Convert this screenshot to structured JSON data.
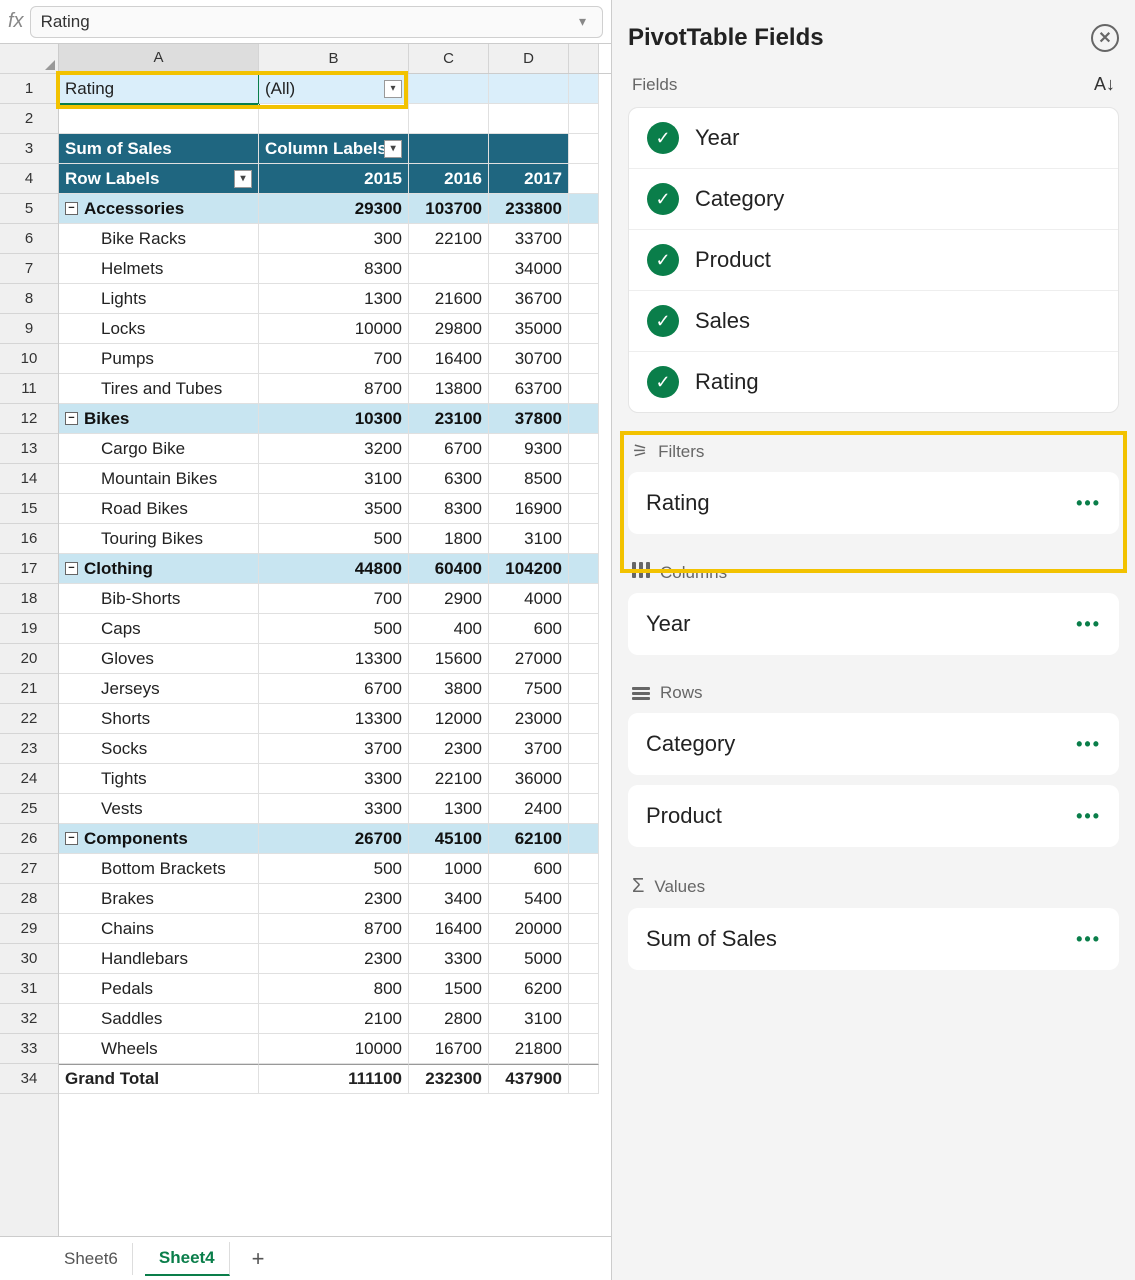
{
  "formula_bar": {
    "fx": "fx",
    "value": "Rating"
  },
  "columns": [
    "A",
    "B",
    "C",
    "D"
  ],
  "row_numbers": [
    1,
    2,
    3,
    4,
    5,
    6,
    7,
    8,
    9,
    10,
    11,
    12,
    13,
    14,
    15,
    16,
    17,
    18,
    19,
    20,
    21,
    22,
    23,
    24,
    25,
    26,
    27,
    28,
    29,
    30,
    31,
    32,
    33,
    34
  ],
  "pivot": {
    "filter_label": "Rating",
    "filter_value": "(All)",
    "sum_label": "Sum of Sales",
    "col_label": "Column Labels",
    "row_label": "Row Labels",
    "years": [
      "2015",
      "2016",
      "2017"
    ],
    "groups": [
      {
        "name": "Accessories",
        "totals": [
          "29300",
          "103700",
          "233800"
        ],
        "rows": [
          {
            "name": "Bike Racks",
            "v": [
              "300",
              "22100",
              "33700"
            ]
          },
          {
            "name": "Helmets",
            "v": [
              "8300",
              "",
              "34000"
            ]
          },
          {
            "name": "Lights",
            "v": [
              "1300",
              "21600",
              "36700"
            ]
          },
          {
            "name": "Locks",
            "v": [
              "10000",
              "29800",
              "35000"
            ]
          },
          {
            "name": "Pumps",
            "v": [
              "700",
              "16400",
              "30700"
            ]
          },
          {
            "name": "Tires and Tubes",
            "v": [
              "8700",
              "13800",
              "63700"
            ]
          }
        ]
      },
      {
        "name": "Bikes",
        "totals": [
          "10300",
          "23100",
          "37800"
        ],
        "rows": [
          {
            "name": "Cargo Bike",
            "v": [
              "3200",
              "6700",
              "9300"
            ]
          },
          {
            "name": "Mountain Bikes",
            "v": [
              "3100",
              "6300",
              "8500"
            ]
          },
          {
            "name": "Road Bikes",
            "v": [
              "3500",
              "8300",
              "16900"
            ]
          },
          {
            "name": "Touring Bikes",
            "v": [
              "500",
              "1800",
              "3100"
            ]
          }
        ]
      },
      {
        "name": "Clothing",
        "totals": [
          "44800",
          "60400",
          "104200"
        ],
        "rows": [
          {
            "name": "Bib-Shorts",
            "v": [
              "700",
              "2900",
              "4000"
            ]
          },
          {
            "name": "Caps",
            "v": [
              "500",
              "400",
              "600"
            ]
          },
          {
            "name": "Gloves",
            "v": [
              "13300",
              "15600",
              "27000"
            ]
          },
          {
            "name": "Jerseys",
            "v": [
              "6700",
              "3800",
              "7500"
            ]
          },
          {
            "name": "Shorts",
            "v": [
              "13300",
              "12000",
              "23000"
            ]
          },
          {
            "name": "Socks",
            "v": [
              "3700",
              "2300",
              "3700"
            ]
          },
          {
            "name": "Tights",
            "v": [
              "3300",
              "22100",
              "36000"
            ]
          },
          {
            "name": "Vests",
            "v": [
              "3300",
              "1300",
              "2400"
            ]
          }
        ]
      },
      {
        "name": "Components",
        "totals": [
          "26700",
          "45100",
          "62100"
        ],
        "rows": [
          {
            "name": "Bottom Brackets",
            "v": [
              "500",
              "1000",
              "600"
            ]
          },
          {
            "name": "Brakes",
            "v": [
              "2300",
              "3400",
              "5400"
            ]
          },
          {
            "name": "Chains",
            "v": [
              "8700",
              "16400",
              "20000"
            ]
          },
          {
            "name": "Handlebars",
            "v": [
              "2300",
              "3300",
              "5000"
            ]
          },
          {
            "name": "Pedals",
            "v": [
              "800",
              "1500",
              "6200"
            ]
          },
          {
            "name": "Saddles",
            "v": [
              "2100",
              "2800",
              "3100"
            ]
          },
          {
            "name": "Wheels",
            "v": [
              "10000",
              "16700",
              "21800"
            ]
          }
        ]
      }
    ],
    "grand_label": "Grand Total",
    "grand": [
      "111100",
      "232300",
      "437900"
    ]
  },
  "sheets": {
    "tabs": [
      "Sheet6",
      "Sheet4"
    ],
    "active": "Sheet4"
  },
  "panel": {
    "title": "PivotTable Fields",
    "fields_label": "Fields",
    "fields": [
      "Year",
      "Category",
      "Product",
      "Sales",
      "Rating"
    ],
    "filters": {
      "label": "Filters",
      "items": [
        "Rating"
      ]
    },
    "cols": {
      "label": "Columns",
      "items": [
        "Year"
      ]
    },
    "rows": {
      "label": "Rows",
      "items": [
        "Category",
        "Product"
      ]
    },
    "values": {
      "label": "Values",
      "items": [
        "Sum of Sales"
      ]
    }
  }
}
